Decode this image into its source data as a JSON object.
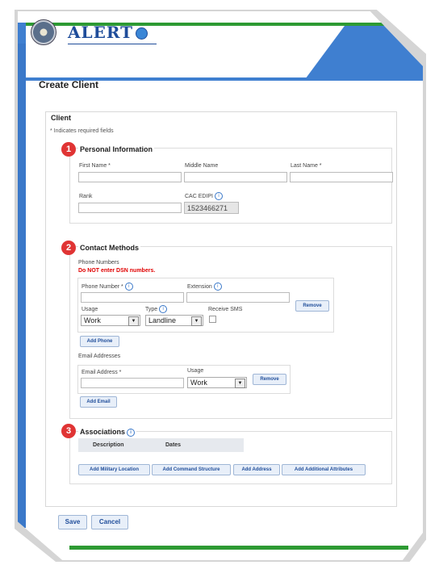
{
  "header": {
    "app_name": "Alert"
  },
  "page": {
    "title": "Create Client"
  },
  "client_section": {
    "legend": "Client",
    "required_note": "* Indicates required fields"
  },
  "personal": {
    "step": "1",
    "legend": "Personal Information",
    "first_name_label": "First Name *",
    "middle_name_label": "Middle Name",
    "last_name_label": "Last Name *",
    "rank_label": "Rank",
    "cac_label": "CAC EDIPI",
    "cac_value": "1523466271"
  },
  "contact": {
    "step": "2",
    "legend": "Contact Methods",
    "phone_numbers_label": "Phone Numbers",
    "warning": "Do NOT enter DSN numbers.",
    "phone_number_label": "Phone Number *",
    "extension_label": "Extension",
    "usage_label": "Usage",
    "type_label": "Type",
    "receive_sms_label": "Receive SMS",
    "usage_value": "Work",
    "type_value": "Landline",
    "remove_label": "Remove",
    "add_phone_label": "Add Phone",
    "email_addresses_label": "Email Addresses",
    "email_address_label": "Email Address *",
    "email_usage_label": "Usage",
    "email_usage_value": "Work",
    "email_remove_label": "Remove",
    "add_email_label": "Add Email"
  },
  "associations": {
    "step": "3",
    "legend": "Associations",
    "columns": [
      "Description",
      "Dates"
    ],
    "buttons": [
      "Add Military Location",
      "Add Command Structure",
      "Add Address",
      "Add Additional Attributes"
    ]
  },
  "footer": {
    "save_label": "Save",
    "cancel_label": "Cancel"
  },
  "colors": {
    "accent": "#3f7fd0",
    "green": "#2d9a33",
    "step": "#e03434",
    "warning": "#e00000"
  }
}
